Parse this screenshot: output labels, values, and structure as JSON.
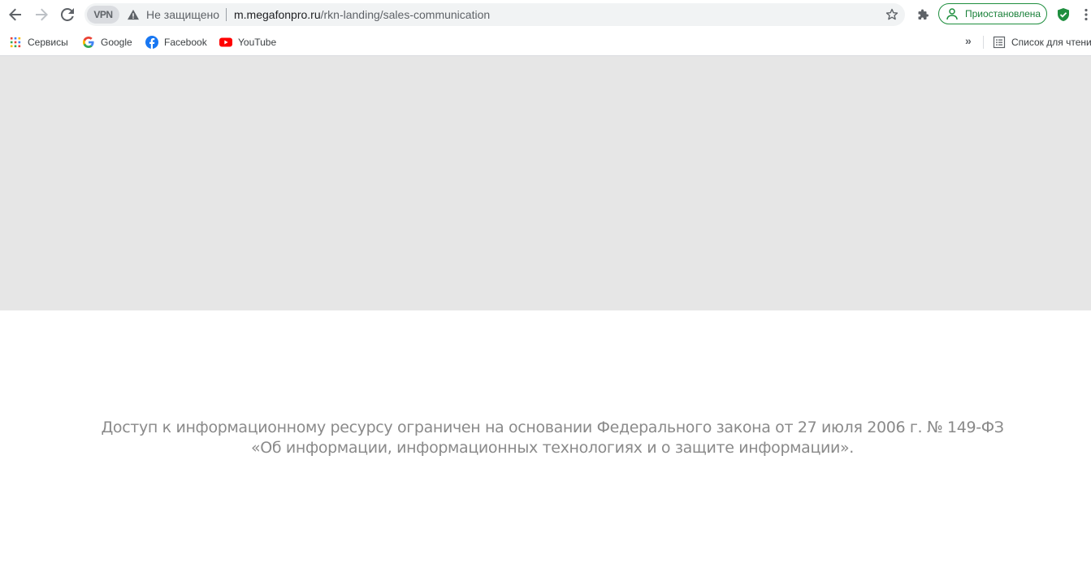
{
  "toolbar": {
    "vpn_label": "VPN",
    "security_text": "Не защищено",
    "url_host": "m.megafonpro.ru",
    "url_path": "/rkn-landing/sales-communication",
    "profile_label": "Приостановлена"
  },
  "bookmarks": {
    "items": [
      {
        "label": "Сервисы",
        "icon": "apps-grid-icon"
      },
      {
        "label": "Google",
        "icon": "google-icon"
      },
      {
        "label": "Facebook",
        "icon": "facebook-icon"
      },
      {
        "label": "YouTube",
        "icon": "youtube-icon"
      }
    ],
    "overflow": "»",
    "reading_list": "Список для чтения"
  },
  "page": {
    "notice_line1": "Доступ к информационному ресурсу ограничен на основании Федерального закона от 27 июля 2006 г. № 149-ФЗ",
    "notice_line2": "«Об информации, информационных технологиях и о защите информации»."
  },
  "colors": {
    "banner": "#e6e6e6",
    "notice_text": "#8a8a8a",
    "profile_green": "#1e8e3e"
  }
}
